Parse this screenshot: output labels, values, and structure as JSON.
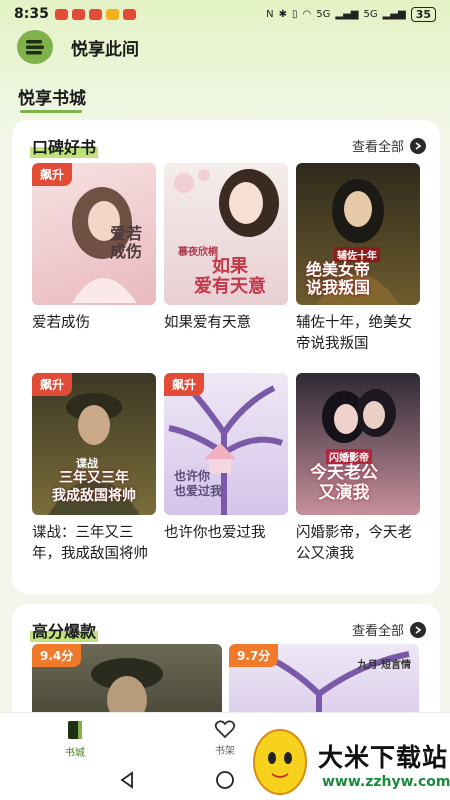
{
  "status_bar": {
    "time": "8:35",
    "signal_1": "5G",
    "signal_2": "5G",
    "battery": "35"
  },
  "app": {
    "title": "悦享此间"
  },
  "tabs": {
    "active": "悦享书城"
  },
  "section1": {
    "title": "口碑好书",
    "see_all": "查看全部",
    "books": [
      {
        "title": "爱若成伤",
        "badge": "飙升",
        "cover_text": "爱若\n成伤",
        "colors": [
          "#f5d7d7",
          "#e8b8bd"
        ]
      },
      {
        "title": "如果爱有天意",
        "badge": "",
        "cover_text": "如果\n爱有天意",
        "cover_small": "慕夜欣桐",
        "colors": [
          "#f2ece8",
          "#e5c9cf"
        ]
      },
      {
        "title": "辅佐十年，绝美女帝说我叛国",
        "badge": "",
        "cover_text": "绝美女帝\n说我叛国",
        "cover_small": "辅佐十年",
        "colors": [
          "#3a3420",
          "#6a5a2e"
        ]
      },
      {
        "title": "谍战：三年又三年，我成敌国将帅",
        "badge": "飙升",
        "cover_text": "三年又三年\n我成敌国将帅",
        "cover_small": "谍战",
        "colors": [
          "#3e3a26",
          "#6d6435"
        ]
      },
      {
        "title": "也许你也爱过我",
        "badge": "飙升",
        "cover_text": "也许你\n也爱过我",
        "colors": [
          "#c9b8e0",
          "#efe8f5"
        ]
      },
      {
        "title": "闪婚影帝，今天老公又演我",
        "badge": "",
        "cover_text": "今天老公\n又演我",
        "cover_small": "闪婚影帝",
        "colors": [
          "#2b2730",
          "#d8a7b0"
        ]
      }
    ]
  },
  "section2": {
    "title": "高分爆款",
    "see_all": "查看全部",
    "books": [
      {
        "badge": "9.4分",
        "colors": [
          "#4a4a3a",
          "#8a8a72"
        ]
      },
      {
        "badge": "9.7分",
        "cover_small": "九月·短言情",
        "colors": [
          "#c9b8e0",
          "#efe8f5"
        ]
      }
    ]
  },
  "bottom_nav": {
    "items": [
      {
        "label": "书城"
      },
      {
        "label": "书架"
      }
    ]
  },
  "watermark": {
    "text": "大米下载站",
    "url": "www.zzhyw.com"
  }
}
